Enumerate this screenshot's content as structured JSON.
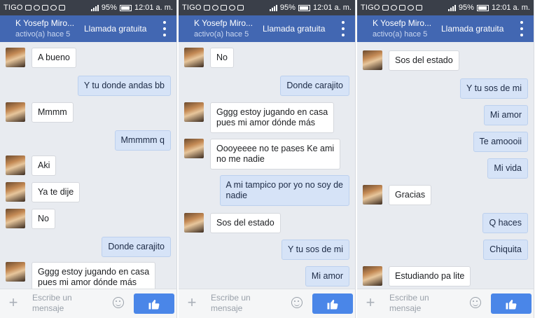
{
  "status_bar": {
    "carrier": "TIGO",
    "battery": "95%",
    "time": "12:01 a. m."
  },
  "header": {
    "contact_name": "K Yosefp Miro...",
    "status": "activo(a) hace 5",
    "call_label": "Llamada gratuita"
  },
  "composer": {
    "placeholder": "Escribe un\nmensaje"
  },
  "colors": {
    "header": "#4267b2",
    "status_bar": "#3a3f49",
    "like_button": "#4a86e8",
    "incoming_bubble": "#ffffff",
    "outgoing_bubble": "#d6e3f7"
  },
  "icons": [
    "notification-icon",
    "image-icon",
    "cloud-icon",
    "messenger-icon",
    "voicemail-icon",
    "signal-icon",
    "battery-icon",
    "overflow-menu-icon",
    "plus-icon",
    "emoji-icon",
    "thumbs-up-icon"
  ],
  "panels": [
    {
      "messages": [
        {
          "dir": "in",
          "text": "A bueno"
        },
        {
          "dir": "out",
          "text": "Y tu donde andas bb"
        },
        {
          "dir": "in",
          "text": "Mmmm"
        },
        {
          "dir": "out",
          "text": "Mmmmm q"
        },
        {
          "dir": "in",
          "text": "Aki"
        },
        {
          "dir": "in",
          "text": "Ya te dije"
        },
        {
          "dir": "in",
          "text": "No"
        },
        {
          "dir": "out",
          "text": "Donde carajito"
        },
        {
          "dir": "in",
          "text": "Gggg estoy jugando en casa\npues mi amor dónde más"
        }
      ]
    },
    {
      "messages": [
        {
          "dir": "in",
          "text": "No"
        },
        {
          "dir": "out",
          "text": "Donde carajito"
        },
        {
          "dir": "in",
          "text": "Gggg estoy jugando en casa\npues mi amor dónde más"
        },
        {
          "dir": "in",
          "text": "Oooyeeee no te pases Ke ami\nno me nadie"
        },
        {
          "dir": "out",
          "text": "A mi tampico por  yo no soy de\nnadie"
        },
        {
          "dir": "in",
          "text": "Sos del estado"
        },
        {
          "dir": "out",
          "text": "Y tu sos de mi"
        },
        {
          "dir": "out",
          "text": "Mi amor"
        }
      ]
    },
    {
      "messages": [
        {
          "dir": "in",
          "text": "Sos del estado"
        },
        {
          "dir": "out",
          "text": "Y tu sos de mi"
        },
        {
          "dir": "out",
          "text": "Mi amor"
        },
        {
          "dir": "out",
          "text": "Te amoooii"
        },
        {
          "dir": "out",
          "text": "Mi vida"
        },
        {
          "dir": "in",
          "text": "Gracias"
        },
        {
          "dir": "out",
          "text": "Q haces"
        },
        {
          "dir": "out",
          "text": "Chiquita"
        },
        {
          "dir": "in",
          "text": "Estudiando pa lite"
        }
      ]
    }
  ]
}
